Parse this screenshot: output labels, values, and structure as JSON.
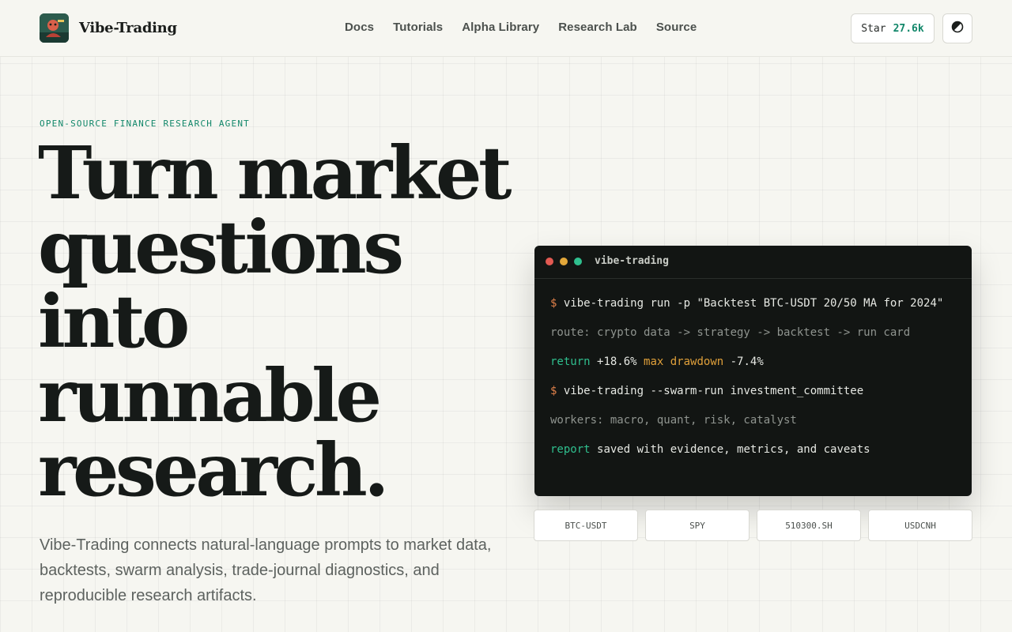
{
  "brand": {
    "name": "Vibe-Trading",
    "logo_icon": "avatar-logo-icon"
  },
  "nav": {
    "items": [
      {
        "label": "Docs"
      },
      {
        "label": "Tutorials"
      },
      {
        "label": "Alpha Library"
      },
      {
        "label": "Research Lab"
      },
      {
        "label": "Source"
      }
    ]
  },
  "header_actions": {
    "star_label": "Star",
    "star_count": "27.6k",
    "theme_icon": "contrast-icon"
  },
  "hero": {
    "eyebrow": "OPEN-SOURCE FINANCE RESEARCH AGENT",
    "headline_lines": [
      "Turn market",
      "questions",
      "into",
      "runnable",
      "research."
    ],
    "lede": "Vibe-Trading connects natural-language prompts to market data, backtests, swarm analysis, trade-journal diagnostics, and reproducible research artifacts."
  },
  "terminal": {
    "title": "vibe-trading",
    "lines": {
      "cmd1_prompt": "$",
      "cmd1_text": "vibe-trading run -p \"Backtest BTC-USDT 20/50 MA for 2024\"",
      "route": "route: crypto data -> strategy -> backtest -> run card",
      "result_key1": "return",
      "result_val1": "+18.6%",
      "result_key2": "max drawdown",
      "result_val2": "-7.4%",
      "cmd2_prompt": "$",
      "cmd2_text": "vibe-trading --swarm-run investment_committee",
      "workers": "workers: macro, quant, risk, catalyst",
      "report_key": "report",
      "report_text": "saved with evidence, metrics, and caveats"
    }
  },
  "tickers": [
    "BTC-USDT",
    "SPY",
    "510300.SH",
    "USDCNH"
  ],
  "colors": {
    "accent": "#12876a",
    "background": "#f6f6f1",
    "terminal_bg": "#121513",
    "prompt": "#e0814a",
    "highlight_orange": "#e0a03a"
  }
}
